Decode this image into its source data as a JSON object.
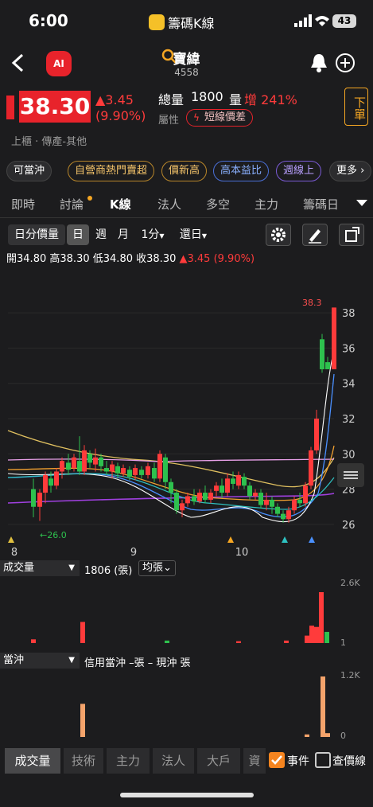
{
  "status": {
    "time": "6:00",
    "app_name": "籌碼K線",
    "battery": "43"
  },
  "header": {
    "title": "寶緯",
    "code": "4558",
    "ai_label": "AI"
  },
  "quote": {
    "price": "38.30",
    "change": "▲3.45",
    "change_pct": "(9.90%)",
    "volume_label": "總量",
    "volume": "1800",
    "volume_inc_label": "量",
    "volume_inc": "增 241%",
    "attr_label": "屬性",
    "attr_tag": "短線價差",
    "market": "上櫃 · 傳產-其他",
    "order_btn": "下單"
  },
  "tags": [
    "可當沖",
    "自營商熱門賣超",
    "價新高",
    "高本益比",
    "週線上",
    "更多"
  ],
  "main_tabs": [
    "即時",
    "討論",
    "K線",
    "法人",
    "多空",
    "主力",
    "籌碼日"
  ],
  "period_tabs": [
    "日分價量",
    "日",
    "週",
    "月",
    "1分",
    "還日"
  ],
  "ohlc": {
    "open_label": "開",
    "open": "34.80",
    "high_label": "高",
    "high": "38.30",
    "low_label": "低",
    "low": "34.80",
    "close_label": "收",
    "close": "38.30",
    "change": "▲3.45 (9.90%)"
  },
  "chart_data": {
    "type": "candlestick",
    "y_ticks": [
      "38",
      "36",
      "34",
      "32",
      "30",
      "28",
      "26"
    ],
    "x_ticks": [
      "8",
      "9",
      "10"
    ],
    "max_label": "38.3",
    "min_label": "←26.0",
    "ylim": [
      25.5,
      38.5
    ]
  },
  "volume_panel": {
    "selector": "成交量",
    "value_text": "1806 (張)",
    "avg_btn": "均張",
    "y_top": "2.6K",
    "y_bottom": "1"
  },
  "daytrade_panel": {
    "selector": "當沖",
    "info": "信用當沖 –張 – 現沖 張",
    "y_top": "1.2K",
    "y_bottom": "0"
  },
  "bottom_tabs": [
    "成交量",
    "技術",
    "主力",
    "法人",
    "大戶",
    "資"
  ],
  "checks": {
    "events": "事件",
    "price_line": "查價線"
  },
  "colors": {
    "up": "#ff3b3b",
    "down": "#2ec14e",
    "accent": "#e8232b"
  }
}
